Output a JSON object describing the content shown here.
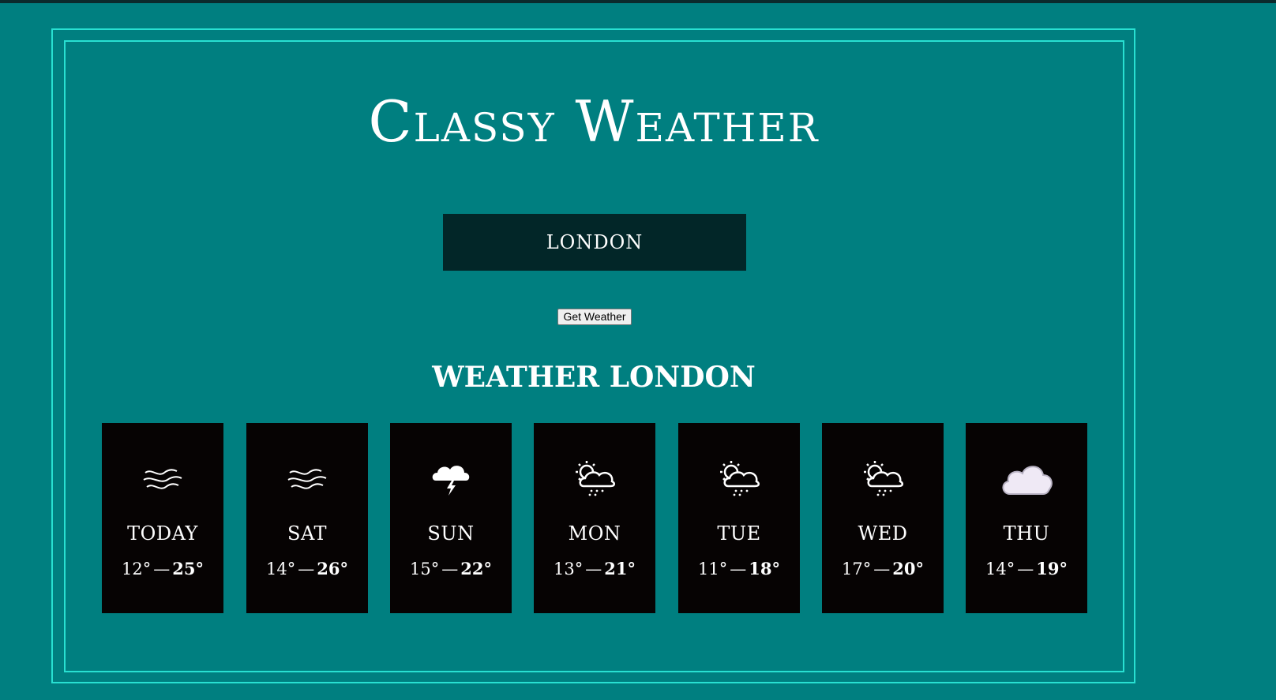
{
  "app": {
    "title": "Classy Weather"
  },
  "search": {
    "value": "LONDON",
    "button_label": "Get Weather"
  },
  "forecast": {
    "heading": "Weather LONDON",
    "separator": "—",
    "days": [
      {
        "name": "TODAY",
        "min": "12°",
        "max": "25°",
        "icon": "wind-icon"
      },
      {
        "name": "SAT",
        "min": "14°",
        "max": "26°",
        "icon": "wind-icon"
      },
      {
        "name": "SUN",
        "min": "15°",
        "max": "22°",
        "icon": "thunder-cloud-icon"
      },
      {
        "name": "MON",
        "min": "13°",
        "max": "21°",
        "icon": "sun-cloud-rain-icon"
      },
      {
        "name": "TUE",
        "min": "11°",
        "max": "18°",
        "icon": "sun-cloud-rain-icon"
      },
      {
        "name": "WED",
        "min": "17°",
        "max": "20°",
        "icon": "sun-cloud-rain-icon"
      },
      {
        "name": "THU",
        "min": "14°",
        "max": "19°",
        "icon": "cloud-icon"
      }
    ]
  },
  "colors": {
    "background": "#007f80",
    "frame": "#28e0d2",
    "card": "#060303",
    "input": "#022628"
  }
}
